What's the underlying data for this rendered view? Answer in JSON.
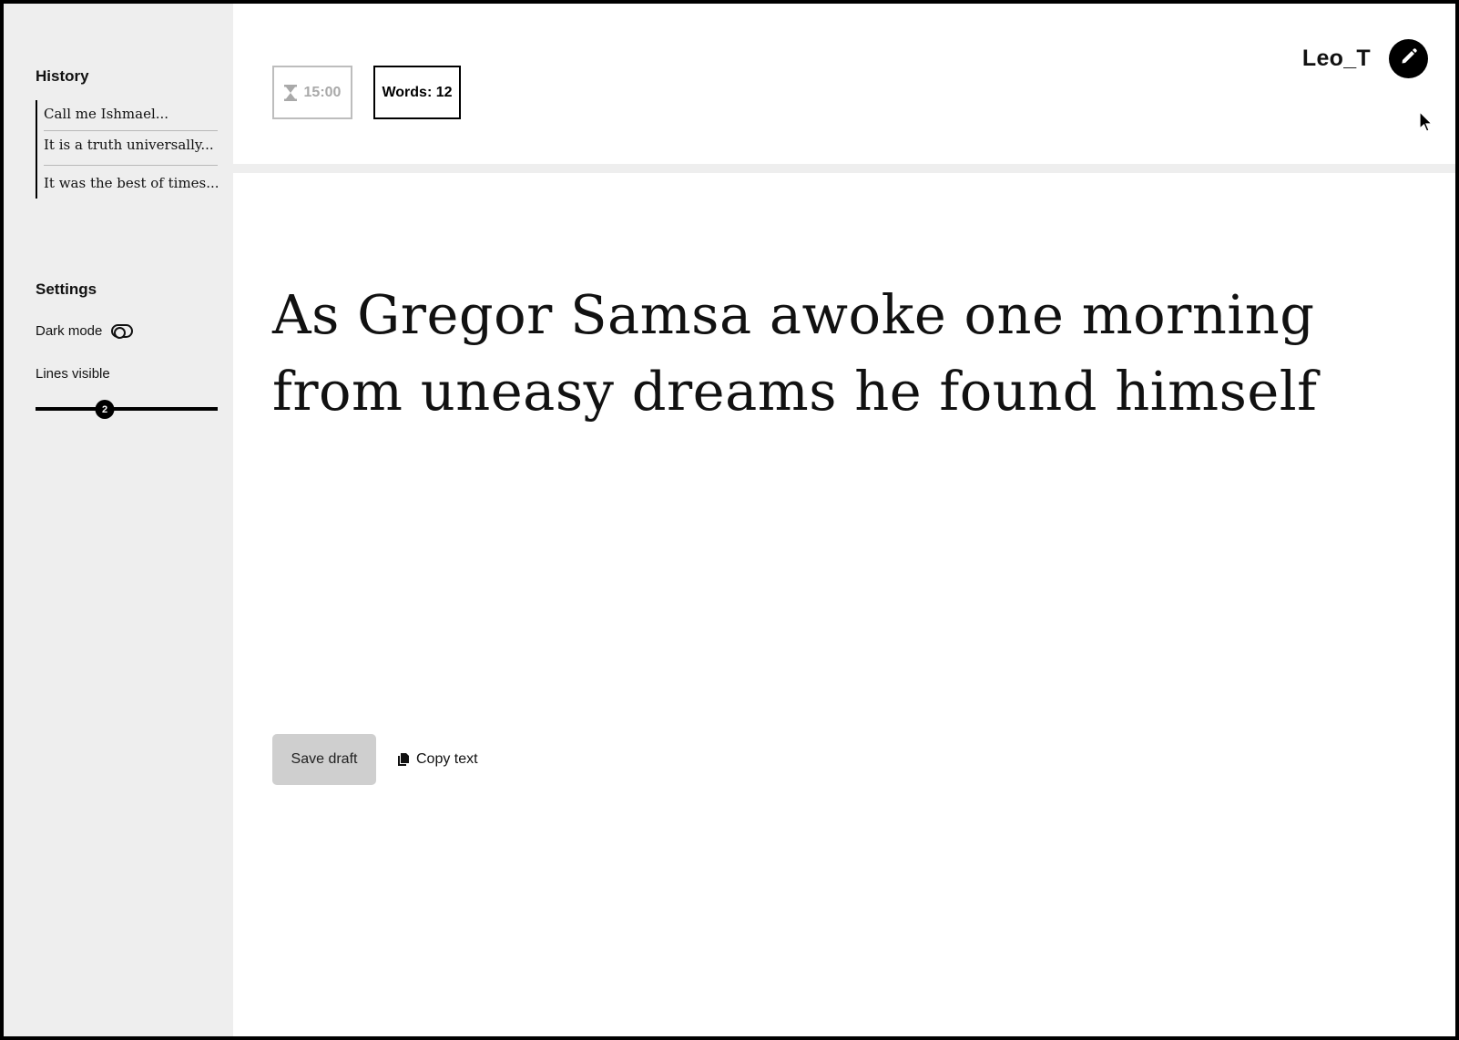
{
  "sidebar": {
    "history_title": "History",
    "history_items": [
      {
        "label": "Call me Ishmael..."
      },
      {
        "label": "It is a truth universally..."
      },
      {
        "label": "It was the best of times..."
      }
    ],
    "settings_title": "Settings",
    "dark_mode_label": "Dark mode",
    "dark_mode_on": false,
    "lines_visible_label": "Lines visible",
    "lines_visible_value": "2",
    "lines_visible_fraction": 0.38
  },
  "topbar": {
    "timer": "15:00",
    "timer_icon": "hourglass-icon",
    "word_count": "Words: 12",
    "username": "Leo_T",
    "edit_icon": "pencil-icon"
  },
  "editor": {
    "text": "As Gregor Samsa awoke one morning from uneasy dreams he found himself"
  },
  "actions": {
    "save_label": "Save draft",
    "copy_label": "Copy text",
    "copy_icon": "copy-icon"
  },
  "colors": {
    "sidebar_bg": "#eeeeee",
    "button_bg": "#cfcfcf",
    "accent": "#000000",
    "muted": "#a9a9a9"
  }
}
